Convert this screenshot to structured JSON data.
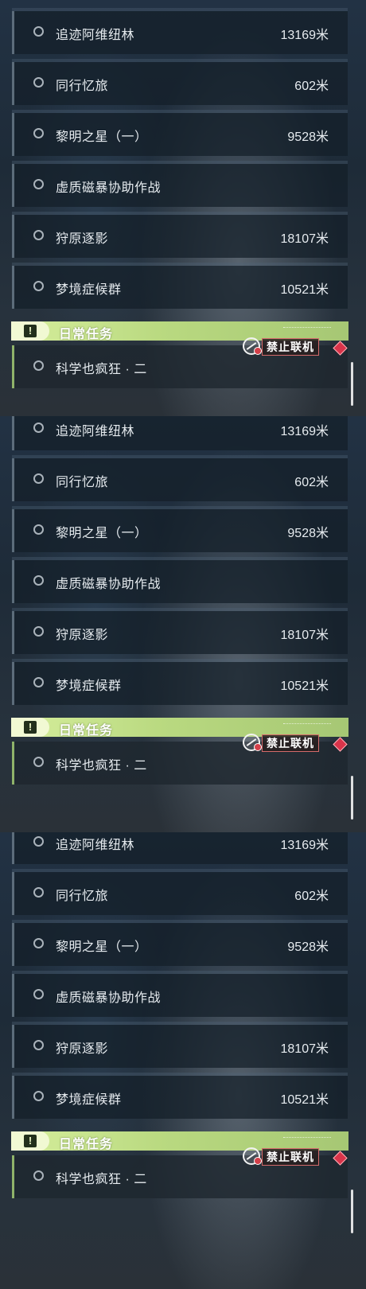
{
  "panels": [
    {
      "quests": [
        {
          "name": "追迹阿维纽林",
          "distance": "13169米"
        },
        {
          "name": "同行忆旅",
          "distance": "602米"
        },
        {
          "name": "黎明之星（一）",
          "distance": "9528米"
        },
        {
          "name": "虚质磁暴协助作战",
          "distance": ""
        },
        {
          "name": "狩原逐影",
          "distance": "18107米"
        },
        {
          "name": "梦境症候群",
          "distance": "10521米"
        }
      ],
      "section_title": "日常任务",
      "daily": {
        "name": "科学也疯狂 · 二"
      },
      "offline_label": "禁止联机"
    },
    {
      "quests": [
        {
          "name": "追迹阿维纽林",
          "distance": "13169米"
        },
        {
          "name": "同行忆旅",
          "distance": "602米"
        },
        {
          "name": "黎明之星（一）",
          "distance": "9528米"
        },
        {
          "name": "虚质磁暴协助作战",
          "distance": ""
        },
        {
          "name": "狩原逐影",
          "distance": "18107米"
        },
        {
          "name": "梦境症候群",
          "distance": "10521米"
        }
      ],
      "section_title": "日常任务",
      "daily": {
        "name": "科学也疯狂 · 二"
      },
      "offline_label": "禁止联机"
    },
    {
      "quests": [
        {
          "name": "追迹阿维纽林",
          "distance": "13169米"
        },
        {
          "name": "同行忆旅",
          "distance": "602米"
        },
        {
          "name": "黎明之星（一）",
          "distance": "9528米"
        },
        {
          "name": "虚质磁暴协助作战",
          "distance": ""
        },
        {
          "name": "狩原逐影",
          "distance": "18107米"
        },
        {
          "name": "梦境症候群",
          "distance": "10521米"
        }
      ],
      "section_title": "日常任务",
      "daily": {
        "name": "科学也疯狂 · 二"
      },
      "offline_label": "禁止联机"
    }
  ],
  "colors": {
    "accent_green": "#b9d980",
    "forbid_red": "#d9344a",
    "text": "#e6ebef"
  },
  "icons": [
    "radio-circle-icon",
    "exclamation-icon",
    "globe-forbidden-icon",
    "red-diamond-icon"
  ]
}
